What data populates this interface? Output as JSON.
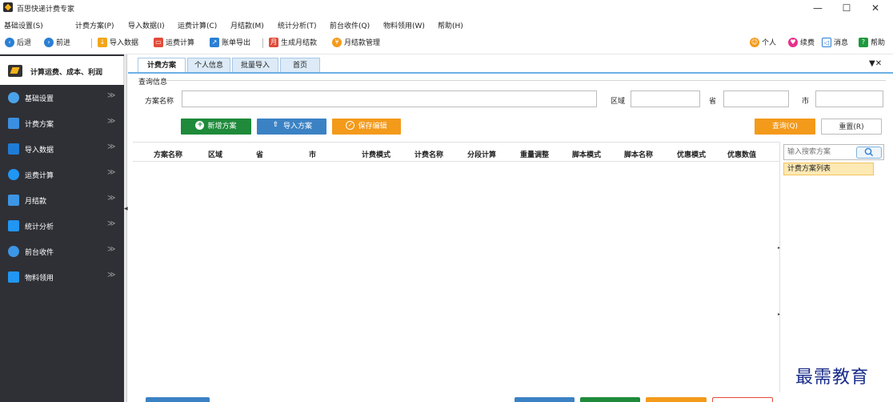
{
  "window": {
    "title": "百思快递计费专家",
    "controls": {
      "minimize": "—",
      "maximize": "☐",
      "close": "✕"
    }
  },
  "menu": [
    "基础设置(S)",
    "计费方案(P)",
    "导入数据(I)",
    "运费计算(C)",
    "月结款(M)",
    "统计分析(T)",
    "前台收件(Q)",
    "物料领用(W)",
    "帮助(H)"
  ],
  "toolbar": {
    "back": "后退",
    "forward": "前进",
    "import": "导入数据",
    "calc": "运费计算",
    "export": "账单导出",
    "gen_monthly": "生成月结款",
    "monthly_mgmt": "月结款管理",
    "personal": "个人",
    "renew": "续费",
    "messages": "消息",
    "help": "帮助"
  },
  "sidebar": {
    "title": "计算运费、成本、利润",
    "items": [
      {
        "label": "基础设置",
        "icon": "gear-icon",
        "color": "#4aa3e8"
      },
      {
        "label": "计费方案",
        "icon": "plan-icon",
        "color": "#3b8fe0"
      },
      {
        "label": "导入数据",
        "icon": "excel-icon",
        "color": "#1f7cd6"
      },
      {
        "label": "运费计算",
        "icon": "grid-icon",
        "color": "#2196f3"
      },
      {
        "label": "月结款",
        "icon": "folder-icon",
        "color": "#3d95e6"
      },
      {
        "label": "统计分析",
        "icon": "chart-icon",
        "color": "#2196f3"
      },
      {
        "label": "前台收件",
        "icon": "box-icon",
        "color": "#3d95e6"
      },
      {
        "label": "物料领用",
        "icon": "supply-icon",
        "color": "#2196f3"
      }
    ]
  },
  "tabs": [
    "计费方案",
    "个人信息",
    "批量导入",
    "首页"
  ],
  "tab_tools": "▼✕",
  "query": {
    "section_title": "查询信息",
    "plan_name_label": "方案名称",
    "region_label": "区域",
    "province_label": "省",
    "city_label": "市",
    "plan_name_value": "",
    "region_value": "",
    "province_value": "",
    "city_value": ""
  },
  "buttons": {
    "new_plan": "新增方案",
    "import_plan": "导入方案",
    "save_edit": "保存编辑",
    "search": "查询(Q)",
    "reset": "重置(R)"
  },
  "table": {
    "columns": [
      "方案名称",
      "区域",
      "省",
      "市",
      "计费模式",
      "计费名称",
      "分段计算",
      "重量调整",
      "脚本模式",
      "脚本名称",
      "优惠模式",
      "优惠数值"
    ],
    "rows": []
  },
  "side_panel": {
    "search_placeholder": "输入搜索方案",
    "list_header": "计费方案列表"
  },
  "watermark": "最需教育",
  "colors": {
    "sidebar_bg": "#2f3036",
    "green": "#1e8a3a",
    "blue": "#3b82c4",
    "orange": "#f39a1b",
    "tab_accent": "#6cb0e4"
  }
}
